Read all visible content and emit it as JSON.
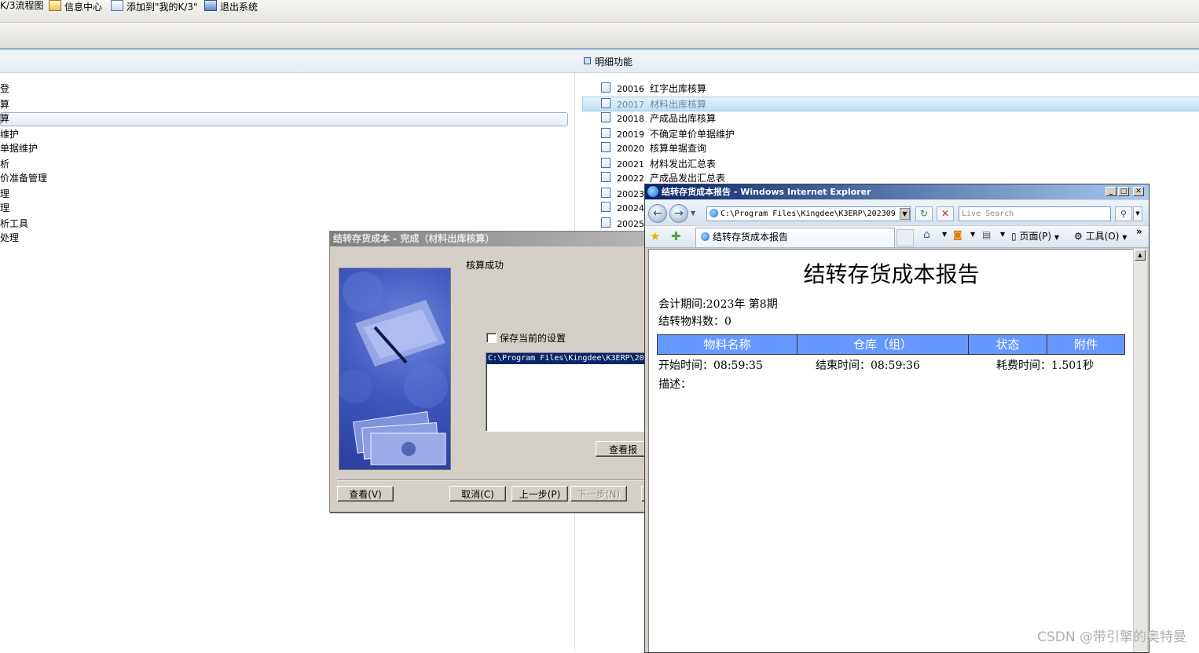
{
  "toolbar": {
    "items": [
      "K/3流程图",
      "信息中心",
      "添加到\"我的K/3\"",
      "退出系统"
    ]
  },
  "left_panel": {
    "items": [
      "登",
      "算",
      "算",
      "维护",
      "单据维护",
      "析",
      "价准备管理",
      "理",
      "理",
      "析工具",
      "处理"
    ]
  },
  "detail_panel": {
    "title": "明细功能",
    "items": [
      {
        "code": "20016",
        "label": "红字出库核算"
      },
      {
        "code": "20017",
        "label": "材料出库核算"
      },
      {
        "code": "20018",
        "label": "产成品出库核算"
      },
      {
        "code": "20019",
        "label": "不确定单价单据维护"
      },
      {
        "code": "20020",
        "label": "核算单据查询"
      },
      {
        "code": "20021",
        "label": "材料发出汇总表"
      },
      {
        "code": "20022",
        "label": "产成品发出汇总表"
      },
      {
        "code": "20023",
        "label": ""
      },
      {
        "code": "20024",
        "label": ""
      },
      {
        "code": "20025",
        "label": ""
      }
    ]
  },
  "wizard": {
    "title": "结转存货成本 - 完成（材料出库核算）",
    "status": "核算成功",
    "checkbox_label": "保存当前的设置",
    "list_item": "C:\\Program Files\\Kingdee\\K3ERP\\20",
    "view_report_label": "查看报",
    "buttons": {
      "view": "查看(V)",
      "cancel": "取消(C)",
      "prev": "上一步(P)",
      "next": "下一步(N)"
    }
  },
  "ie": {
    "title": "结转存货成本报告 - Windows Internet Explorer",
    "address": "C:\\Program Files\\Kingdee\\K3ERP\\202309",
    "search_placeholder": "Live Search",
    "tab_label": "结转存货成本报告",
    "page_menu": "页面(P)",
    "tools_menu": "工具(O)",
    "report": {
      "title": "结转存货成本报告",
      "period": "会计期间:2023年 第8期",
      "count": "结转物料数：0",
      "columns": [
        "物料名称",
        "仓库（组）",
        "状态",
        "附件"
      ],
      "start_time": "开始时间：08:59:35",
      "end_time": "结束时间：08:59:36",
      "duration": "耗费时间：1.501秒",
      "description": "描述："
    }
  },
  "watermark": "CSDN @带引擎的奥特曼",
  "colors": {
    "ie_title_start": "#0a246a",
    "selection_blue": "#bde0f4",
    "report_header": "#6699ff",
    "wizard_face": "#d4d0c8"
  }
}
